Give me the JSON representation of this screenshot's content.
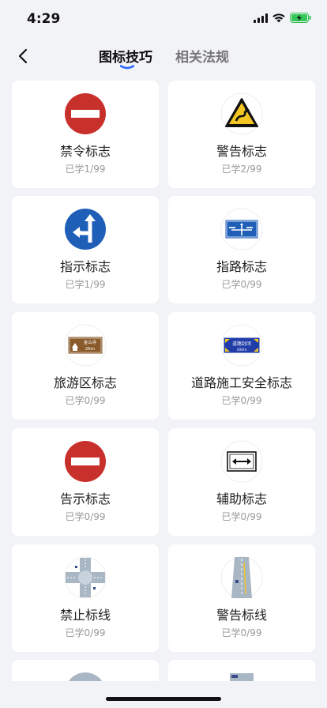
{
  "status": {
    "time": "4:29"
  },
  "nav": {
    "tabs": [
      {
        "label": "图标技巧",
        "active": true
      },
      {
        "label": "相关法规",
        "active": false
      }
    ]
  },
  "colors": {
    "accent": "#2f6bff",
    "red": "#c8302c",
    "blue": "#1f5fb8"
  },
  "cards": [
    {
      "title": "禁令标志",
      "progress": "已学1/99",
      "icon": "no-entry-icon"
    },
    {
      "title": "警告标志",
      "progress": "已学2/99",
      "icon": "winding-road-warning-icon"
    },
    {
      "title": "指示标志",
      "progress": "已学1/99",
      "icon": "straight-or-left-icon"
    },
    {
      "title": "指路标志",
      "progress": "已学0/99",
      "icon": "direction-guide-sign-icon"
    },
    {
      "title": "旅游区标志",
      "progress": "已学0/99",
      "icon": "tourist-area-sign-icon"
    },
    {
      "title": "道路施工安全标志",
      "progress": "已学0/99",
      "icon": "road-closed-sign-icon"
    },
    {
      "title": "告示标志",
      "progress": "已学0/99",
      "icon": "no-entry-notice-icon"
    },
    {
      "title": "辅助标志",
      "progress": "已学0/99",
      "icon": "two-way-arrow-sign-icon"
    },
    {
      "title": "禁止标线",
      "progress": "已学0/99",
      "icon": "intersection-marking-icon"
    },
    {
      "title": "警告标线",
      "progress": "已学0/99",
      "icon": "road-marking-warning-icon"
    }
  ],
  "signs": {
    "tourist": {
      "line1": "金山寺",
      "line2": "2Km"
    },
    "roadwork": {
      "line1": "道路封闭",
      "line2": "300m"
    }
  }
}
